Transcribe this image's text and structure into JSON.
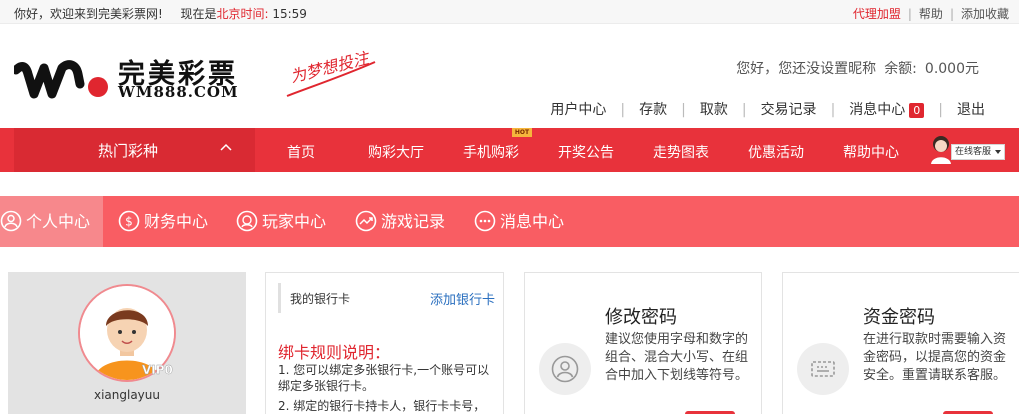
{
  "topbar": {
    "welcome": "你好，欢迎来到完美彩票网!",
    "time_prefix": "现在是",
    "time_label": "北京时间:",
    "time_value": "15:59",
    "agent_join": "代理加盟",
    "help": "帮助",
    "add_favorite": "添加收藏"
  },
  "logo": {
    "name": "完美彩票",
    "domain": "WM888.COM",
    "slogan": "为梦想投注"
  },
  "user": {
    "greeting": "您好，",
    "nickname_notice": "您还没设置昵称",
    "balance_label": "余额:",
    "balance_value": "0.000元"
  },
  "user_nav": {
    "center": "用户中心",
    "deposit": "存款",
    "withdraw": "取款",
    "records": "交易记录",
    "messages": "消息中心",
    "messages_count": "0",
    "logout": "退出"
  },
  "main_nav": {
    "hot_lottery": "热门彩种",
    "items": [
      "首页",
      "购彩大厅",
      "手机购彩",
      "开奖公告",
      "走势图表",
      "优惠活动",
      "帮助中心"
    ],
    "new_tag": "HOT",
    "online_service": "在线客服"
  },
  "sub_nav": {
    "items": [
      "个人中心",
      "财务中心",
      "玩家中心",
      "游戏记录",
      "消息中心"
    ],
    "active_index": 0
  },
  "profile": {
    "vip": "VIP0",
    "username": "xianglayuu"
  },
  "bank": {
    "title": "我的银行卡",
    "add_link": "添加银行卡",
    "rules_title": "绑卡规则说明：",
    "rules": [
      "1. 您可以绑定多张银行卡,一个账号可以绑定多张银行卡。",
      "2. 绑定的银行卡持卡人，银行卡卡号，"
    ]
  },
  "password_card": {
    "title": "修改密码",
    "desc": "建议您使用字母和数字的组合、混合大小写、在组合中加入下划线等符号。"
  },
  "fund_password_card": {
    "title": "资金密码",
    "desc": "在进行取款时需要输入资金密码，以提高您的资金安全。重置请联系客服。"
  },
  "colors": {
    "brand_red": "#e8323b",
    "subnav_red": "#f95d63",
    "link_blue": "#2a6fbf"
  }
}
